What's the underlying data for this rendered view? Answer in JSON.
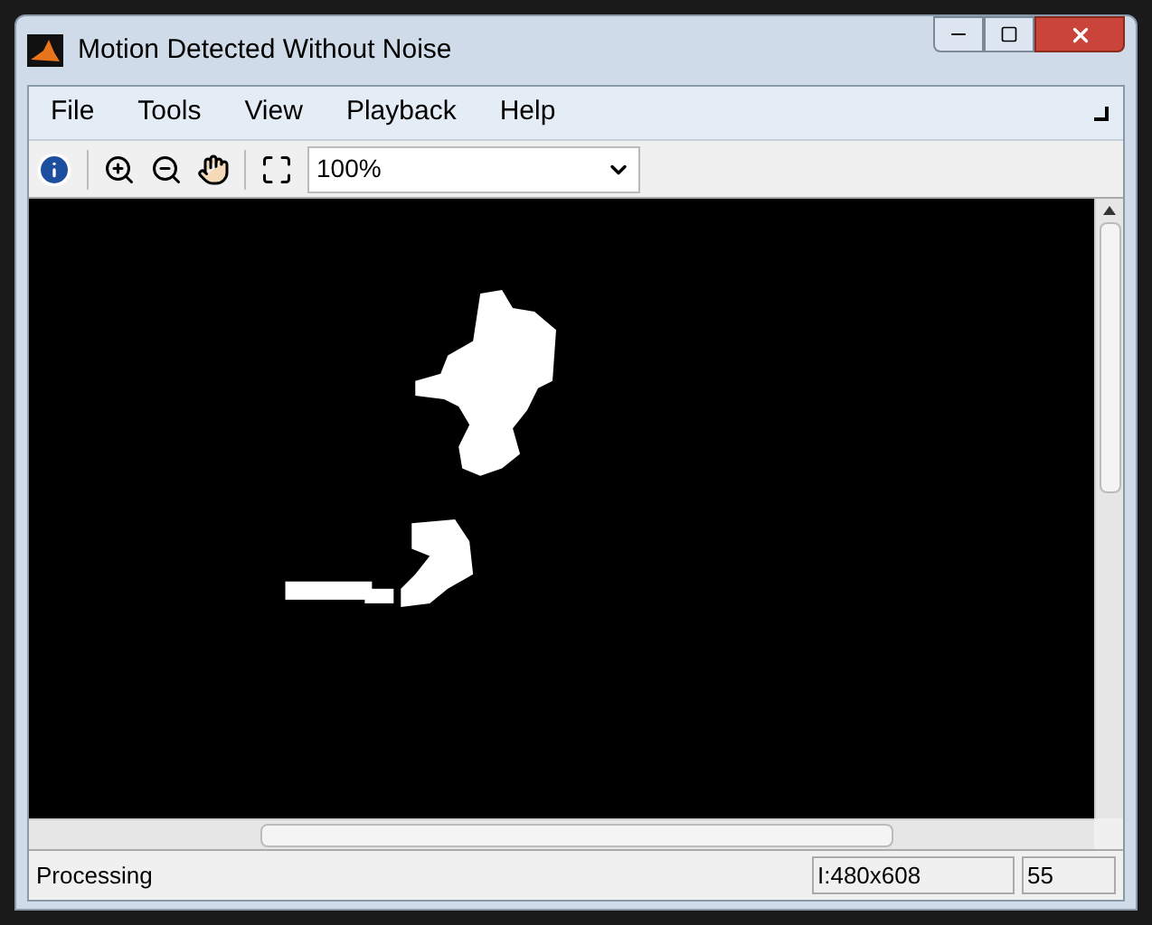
{
  "window": {
    "title": "Motion Detected Without Noise"
  },
  "menu": [
    "File",
    "Tools",
    "View",
    "Playback",
    "Help"
  ],
  "toolbar": {
    "zoom": "100%"
  },
  "status_bar": {
    "message": "Processing",
    "size": "I:480x608",
    "frame": "55"
  }
}
